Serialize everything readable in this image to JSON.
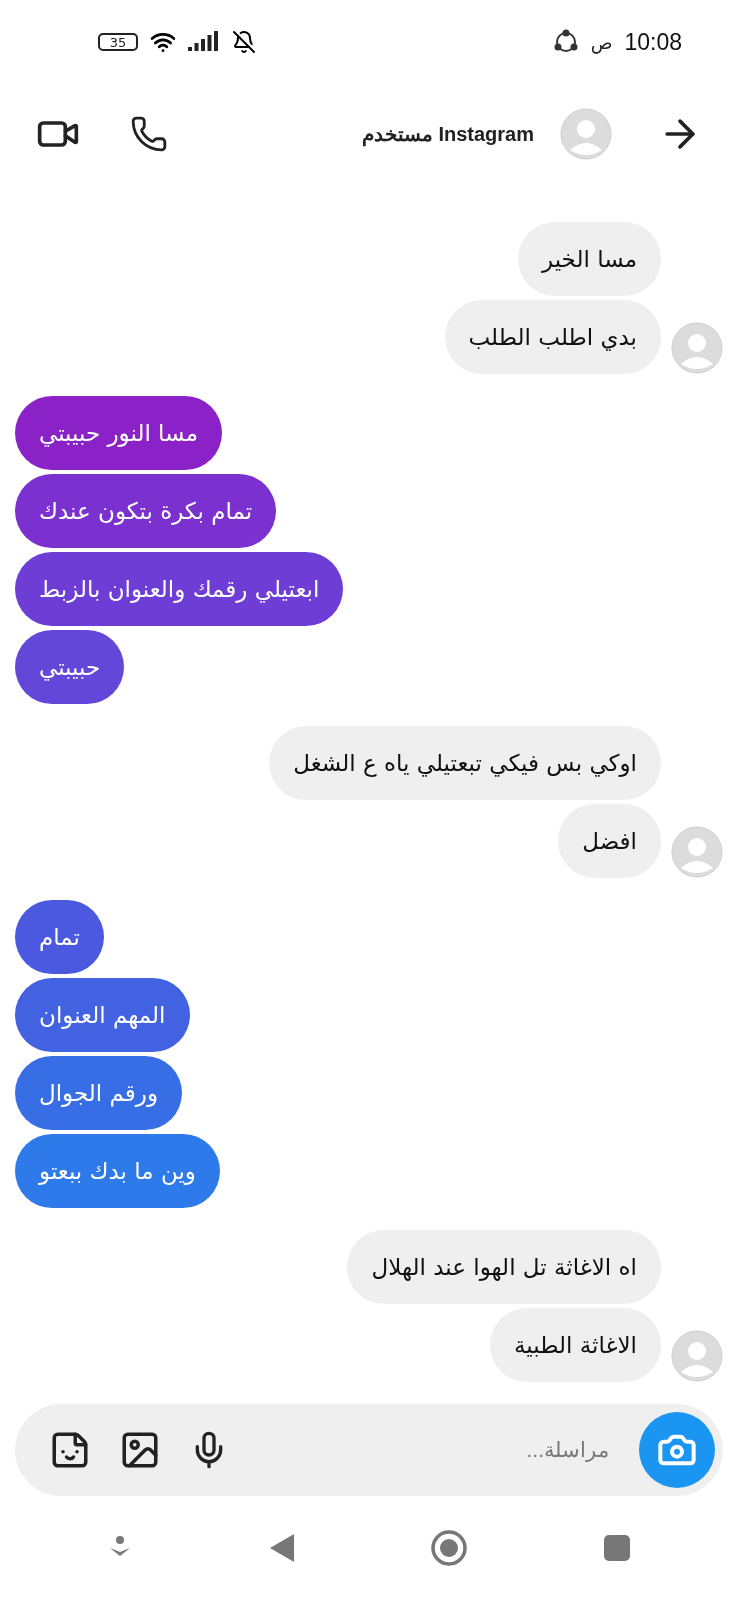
{
  "status_bar": {
    "battery": "35",
    "time": "10:08",
    "period": "ص"
  },
  "header": {
    "title": "مستخدم Instagram"
  },
  "messages": [
    {
      "kind": "received",
      "text": "مسا الخير",
      "avatar": false
    },
    {
      "kind": "received",
      "text": "بدي اطلب الطلب",
      "avatar": true
    },
    {
      "kind": "sent",
      "text": "مسا النور حبيبتي",
      "color": "#8a22c8"
    },
    {
      "kind": "sent",
      "text": "تمام بكرة بتكون عندك",
      "color": "#7a31d0"
    },
    {
      "kind": "sent",
      "text": "ابعتيلي رقمك والعنوان بالزبط",
      "color": "#6d3dd5"
    },
    {
      "kind": "sent",
      "text": "حبيبتي",
      "color": "#6247d8"
    },
    {
      "kind": "received",
      "text": "اوكي بس فيكي تبعتيلي ياه ع الشغل",
      "avatar": false
    },
    {
      "kind": "received",
      "text": "افضل",
      "avatar": true
    },
    {
      "kind": "sent",
      "text": "تمام",
      "color": "#4a59df"
    },
    {
      "kind": "sent",
      "text": "المهم العنوان",
      "color": "#4262e2"
    },
    {
      "kind": "sent",
      "text": "ورقم الجوال",
      "color": "#376ee6"
    },
    {
      "kind": "sent",
      "text": "وين ما بدك ببعتو",
      "color": "#2e7aea"
    },
    {
      "kind": "received",
      "text": "اه الاغاثة تل الهوا عند الهلال",
      "avatar": false
    },
    {
      "kind": "received",
      "text": "الاغاثة الطبية",
      "avatar": true
    }
  ],
  "composer": {
    "placeholder": "مراسلة..."
  }
}
